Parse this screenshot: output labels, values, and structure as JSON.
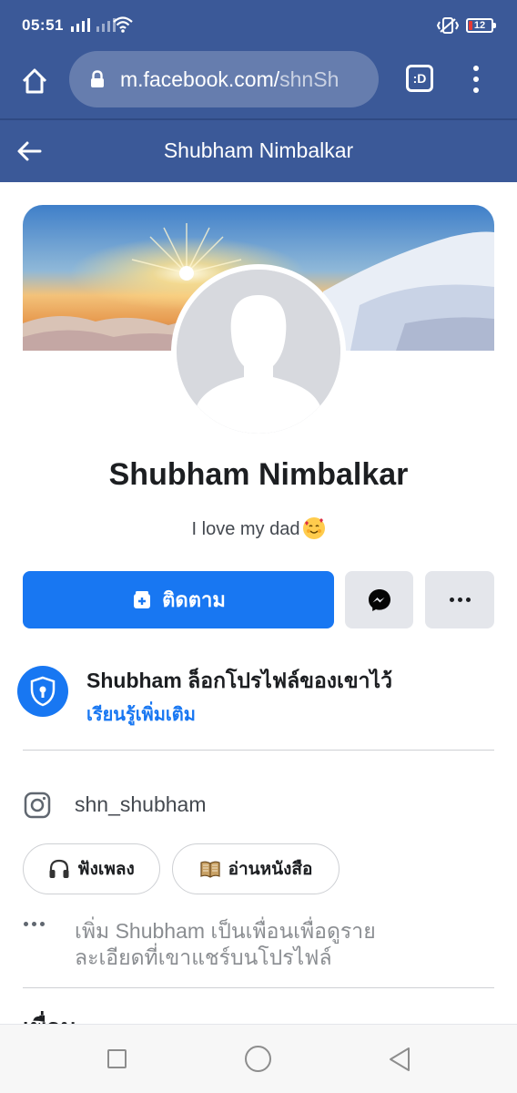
{
  "status_bar": {
    "time": "05:51",
    "battery_level": "12",
    "battery_color": "#e53935"
  },
  "browser": {
    "url_main": "m.facebook.com/",
    "url_path": "shnSh",
    "tabs_label": ":D",
    "icons": [
      "home-icon",
      "lock-icon",
      "tabs-icon",
      "more-vertical-icon"
    ]
  },
  "header": {
    "title": "Shubham Nimbalkar",
    "back_icon": "back-arrow-icon",
    "background": "#3b5998"
  },
  "profile": {
    "name": "Shubham Nimbalkar",
    "bio": "I love my dad",
    "bio_emoji": "smiling-face-with-hearts"
  },
  "actions": {
    "follow_label": "ติดตาม",
    "follow_color": "#1877f2",
    "messenger_icon": "messenger-icon",
    "more_icon": "more-horizontal-icon"
  },
  "locked": {
    "title": "Shubham ล็อกโปรไฟล์ของเขาไว้",
    "learn_more": "เรียนรู้เพิ่มเติม"
  },
  "intro": {
    "instagram": "shn_shubham",
    "hobbies": [
      {
        "label": "ฟังเพลง",
        "icon": "headphones-icon"
      },
      {
        "label": "อ่านหนังสือ",
        "icon": "book-icon"
      }
    ],
    "add_friend_text": "เพิ่ม Shubham เป็นเพื่อนเพื่อดูรายละเอียดที่เขาแชร์บนโปรไฟล์"
  },
  "friends_heading": "เพื่อน"
}
